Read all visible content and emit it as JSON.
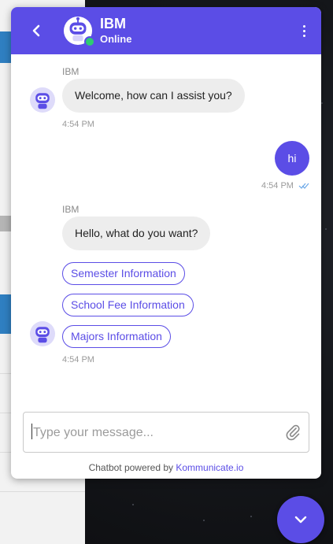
{
  "header": {
    "name": "IBM",
    "status": "Online"
  },
  "messages": [
    {
      "sender": "IBM",
      "text": "Welcome, how can I assist you?",
      "time": "4:54 PM"
    },
    {
      "sender": "user",
      "text": "hi",
      "time": "4:54 PM"
    },
    {
      "sender": "IBM",
      "text": "Hello, what do you want?",
      "time": "4:54 PM"
    }
  ],
  "quick_replies": [
    "Semester Information",
    "School Fee Information",
    "Majors Information"
  ],
  "input": {
    "placeholder": "Type your message..."
  },
  "footer": {
    "prefix": "Chatbot powered by ",
    "link_text": "Kommunicate.io"
  },
  "colors": {
    "primary": "#5b4de6",
    "online": "#2ecc71",
    "bot_bubble": "#ededed",
    "read_receipt": "#6ba8e8"
  },
  "icons": {
    "back": "chevron-left-icon",
    "menu": "vertical-dots-icon",
    "attach": "paperclip-icon",
    "launcher": "chevron-down-icon",
    "read": "double-check-icon"
  }
}
